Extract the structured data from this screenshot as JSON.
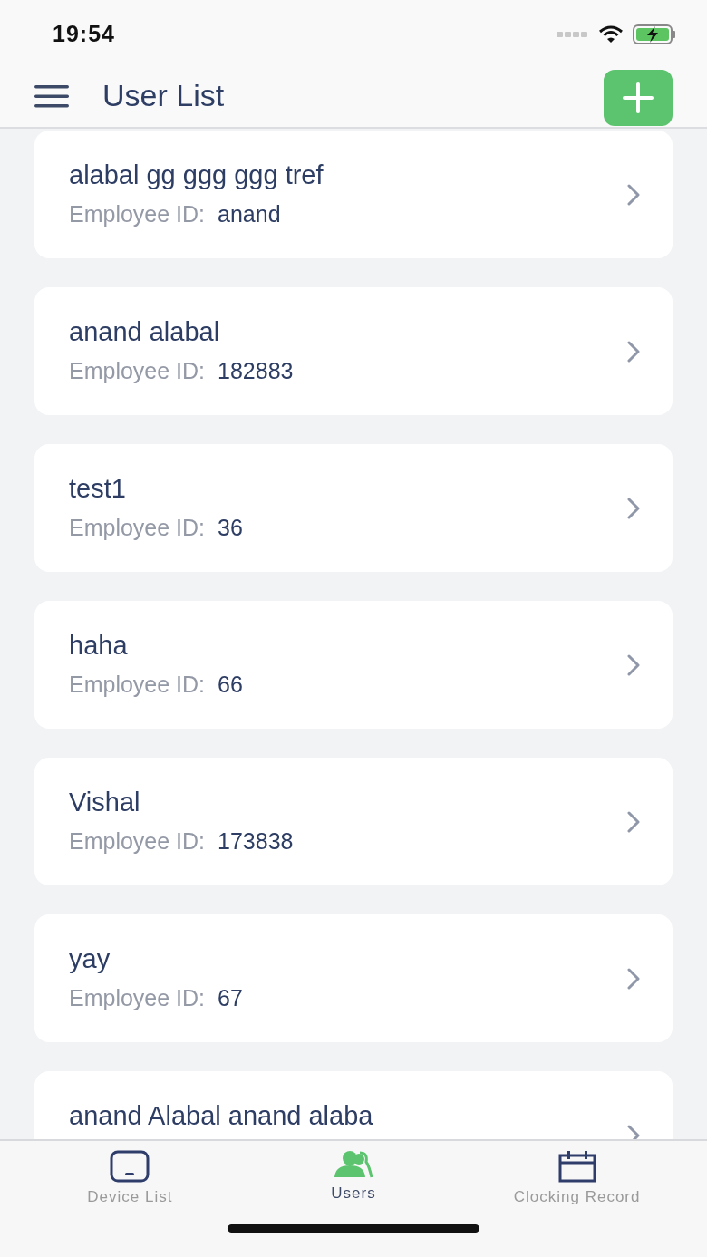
{
  "status_bar": {
    "time": "19:54"
  },
  "header": {
    "title": "User List"
  },
  "users": [
    {
      "name": "alabal gg ggg ggg tref",
      "id_label": "Employee ID:",
      "id": "anand"
    },
    {
      "name": "anand alabal",
      "id_label": "Employee ID:",
      "id": "182883"
    },
    {
      "name": "test1",
      "id_label": "Employee ID:",
      "id": "36"
    },
    {
      "name": "haha",
      "id_label": "Employee ID:",
      "id": "66"
    },
    {
      "name": "Vishal",
      "id_label": "Employee ID:",
      "id": "173838"
    },
    {
      "name": "yay",
      "id_label": "Employee ID:",
      "id": "67"
    },
    {
      "name": "anand Alabal anand alaba"
    }
  ],
  "tab_bar": [
    {
      "label": "Device List",
      "kind": "device",
      "selected": false
    },
    {
      "label": "Users",
      "kind": "users",
      "selected": true
    },
    {
      "label": "Clocking Record",
      "kind": "calendar",
      "selected": false
    }
  ]
}
